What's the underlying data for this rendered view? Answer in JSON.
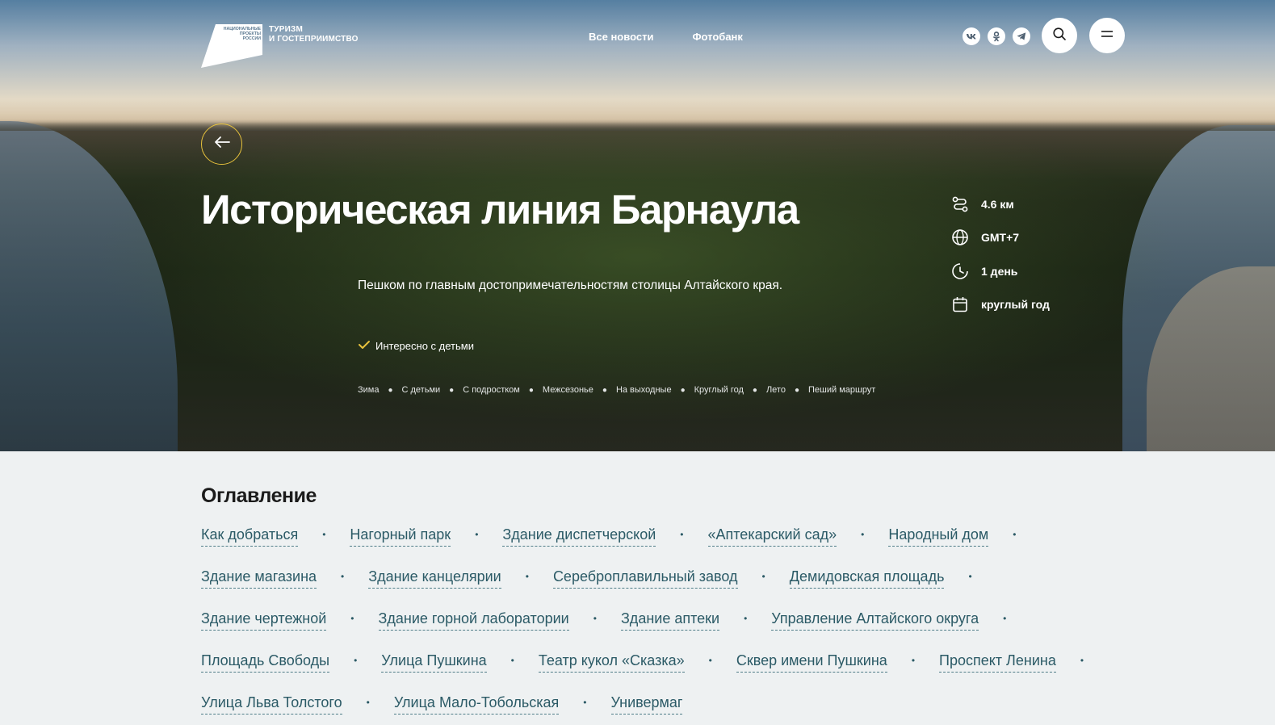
{
  "header": {
    "logo": {
      "mark_text": "НАЦИОНАЛЬНЫЕ ПРОЕКТЫ РОССИИ",
      "line1": "ТУРИЗМ",
      "line2": "И ГОСТЕПРИИМСТВО"
    },
    "nav": [
      {
        "label": "Все новости"
      },
      {
        "label": "Фотобанк"
      }
    ],
    "socials": [
      {
        "label": "VK",
        "icon": "vk-icon"
      },
      {
        "label": "ok",
        "icon": "odnoklassniki-icon"
      },
      {
        "label": "tg",
        "icon": "telegram-icon"
      }
    ],
    "search_icon": "search-icon",
    "menu_icon": "hamburger-menu-icon"
  },
  "hero": {
    "title": "Историческая линия Барнаула",
    "description": "Пешком по главным достопримечательностям столицы Алтайского края.",
    "kids_label": "Интересно с детьми",
    "tags": [
      "Зима",
      "С детьми",
      "С подростком",
      "Межсезонье",
      "На выходные",
      "Круглый год",
      "Лето",
      "Пеший маршрут"
    ],
    "facts": [
      {
        "icon": "route-icon",
        "text": "4.6 км"
      },
      {
        "icon": "globe-icon",
        "text": "GMT+7"
      },
      {
        "icon": "clock-icon",
        "text": "1 день"
      },
      {
        "icon": "calendar-icon",
        "text": "круглый год"
      }
    ],
    "accent_color": "#e7c23c"
  },
  "toc": {
    "heading": "Оглавление",
    "items": [
      "Как добраться",
      "Нагорный парк",
      "Здание диспетчерской",
      "«Аптекарский сад»",
      "Народный дом",
      "Здание магазина",
      "Здание канцелярии",
      "Сереброплавильный завод",
      "Демидовская площадь",
      "Здание чертежной",
      "Здание горной лаборатории",
      "Здание аптеки",
      "Управление Алтайского округа",
      "Площадь Свободы",
      "Улица Пушкина",
      "Театр кукол «Сказка»",
      "Сквер имени Пушкина",
      "Проспект Ленина",
      "Улица Льва Толстого",
      "Улица Мало-Тобольская",
      "Универмаг"
    ],
    "link_color": "#2b5a66"
  }
}
